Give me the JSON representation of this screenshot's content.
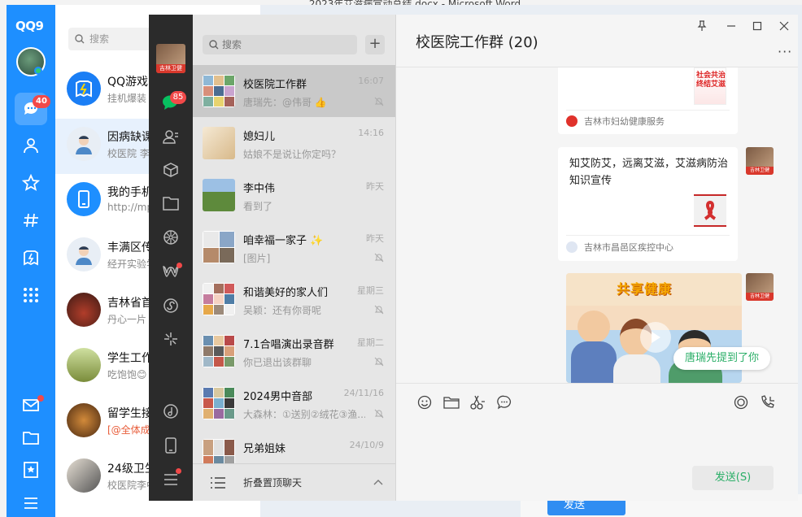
{
  "background_window": {
    "title": "2023年艾滋病宣动总结.docx - Microsoft Word",
    "send_label": "发送"
  },
  "qq": {
    "logo": "QQ9",
    "unread_badge": "40",
    "search_placeholder": "搜索",
    "nav_icons": [
      "chat-icon",
      "contacts-icon",
      "favorites-icon",
      "channels-icon",
      "games-icon",
      "apps-icon",
      "mail-icon",
      "folder-icon",
      "collection-icon",
      "menu-icon"
    ],
    "conversations": [
      {
        "title": "QQ游戏",
        "sub": "挂机爆装"
      },
      {
        "title": "因病缺课",
        "sub": "校医院 李"
      },
      {
        "title": "我的手机",
        "sub": "http://mp"
      },
      {
        "title": "丰满区传",
        "sub": "经开实验学"
      },
      {
        "title": "吉林省首",
        "sub": "丹心一片"
      },
      {
        "title": "学生工作",
        "sub": "吃饱饱😊"
      },
      {
        "title": "留学生接",
        "sub": "[@全体成"
      },
      {
        "title": "24级卫生",
        "sub": "校医院李中伟：新加入的同..."
      }
    ]
  },
  "wechat": {
    "sidebar": {
      "avatar_label": "吉林卫健",
      "chat_badge": "85",
      "icons": [
        "chat-icon",
        "contacts-icon",
        "box-icon",
        "folder-icon",
        "moments-icon",
        "channels-icon",
        "mini-program-icon",
        "search-icon",
        "music-icon",
        "phone-icon",
        "settings-icon"
      ]
    },
    "search_placeholder": "搜索",
    "chats": [
      {
        "title": "校医院工作群",
        "time": "16:07",
        "sub": "唐瑞先：@伟哥 👍",
        "muted": true
      },
      {
        "title": "媳妇儿",
        "time": "14:16",
        "sub": "姑娘不是说让你定吗？",
        "muted": false
      },
      {
        "title": "李中伟",
        "time": "昨天",
        "sub": "看到了",
        "muted": false
      },
      {
        "title": "咱幸福一家子 ✨",
        "time": "昨天",
        "sub": "[图片]",
        "muted": true
      },
      {
        "title": "和谐美好的家人们",
        "time": "星期三",
        "sub": "吴颖：还有你哥呢",
        "muted": true
      },
      {
        "title": "7.1合唱演出录音群",
        "time": "星期二",
        "sub": "你已退出该群聊",
        "muted": true
      },
      {
        "title": "2024男中音部",
        "time": "24/11/16",
        "sub": "大森林：①送别②绒花③渔...",
        "muted": true
      },
      {
        "title": "兄弟姐妹",
        "time": "24/10/9",
        "sub": "",
        "muted": false
      }
    ],
    "fold_label": "折叠置顶聊天",
    "chat": {
      "title": "校医院工作群 (20)",
      "messages": [
        {
          "type": "article",
          "image_caption": "社会共治 终结艾滋",
          "source": "吉林市妇幼健康服务"
        },
        {
          "type": "article",
          "text": "知艾防艾，远离艾滋，艾滋病防治知识宣传",
          "source": "吉林市昌邑区疾控中心",
          "avatar_label": "吉林卫健"
        },
        {
          "type": "video",
          "caption": "共享健康",
          "avatar_label": "吉林卫健"
        }
      ],
      "mention_notice": "唐瑞先提到了你",
      "toolbar_icons": [
        "emoji-icon",
        "folder-icon",
        "scissors-icon",
        "chat-history-icon",
        "live-icon",
        "voice-call-icon"
      ],
      "send_label": "发送(S)"
    }
  },
  "colors": {
    "qq_blue": "#1e8fff",
    "wechat_dark": "#2b2b2b",
    "wechat_green": "#2aae67",
    "badge_red": "#f24949"
  }
}
